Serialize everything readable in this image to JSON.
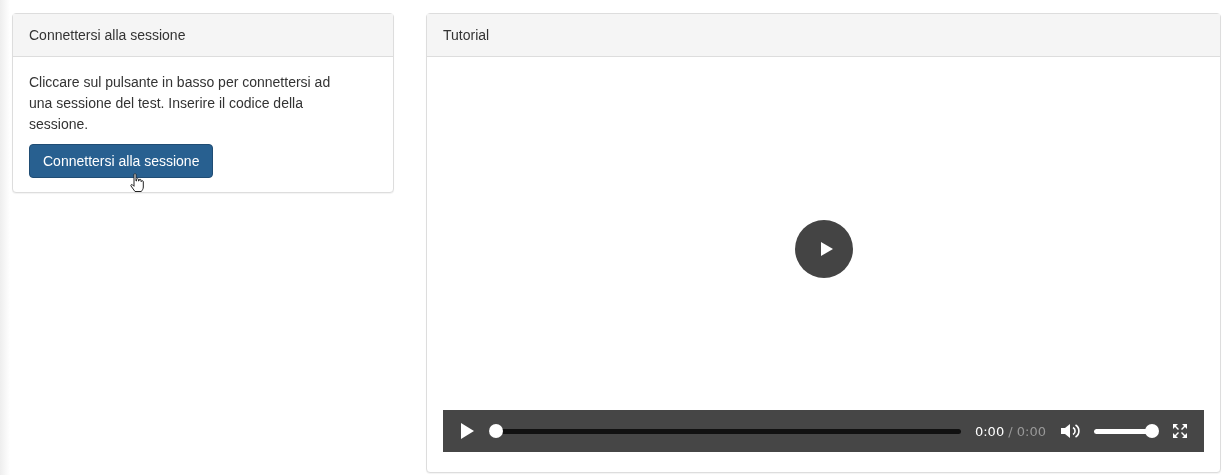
{
  "connect_panel": {
    "title": "Connettersi alla sessione",
    "text": "Cliccare sul pulsante in basso per connettersi ad una sessione del test. Inserire il codice della sessione.",
    "button": "Connettersi alla sessione"
  },
  "tutorial_panel": {
    "title": "Tutorial",
    "player": {
      "current_time": "0:00",
      "separator": "/",
      "duration": "0:00",
      "progress": {
        "level": 0
      },
      "volume": {
        "level": 0.9
      }
    }
  }
}
